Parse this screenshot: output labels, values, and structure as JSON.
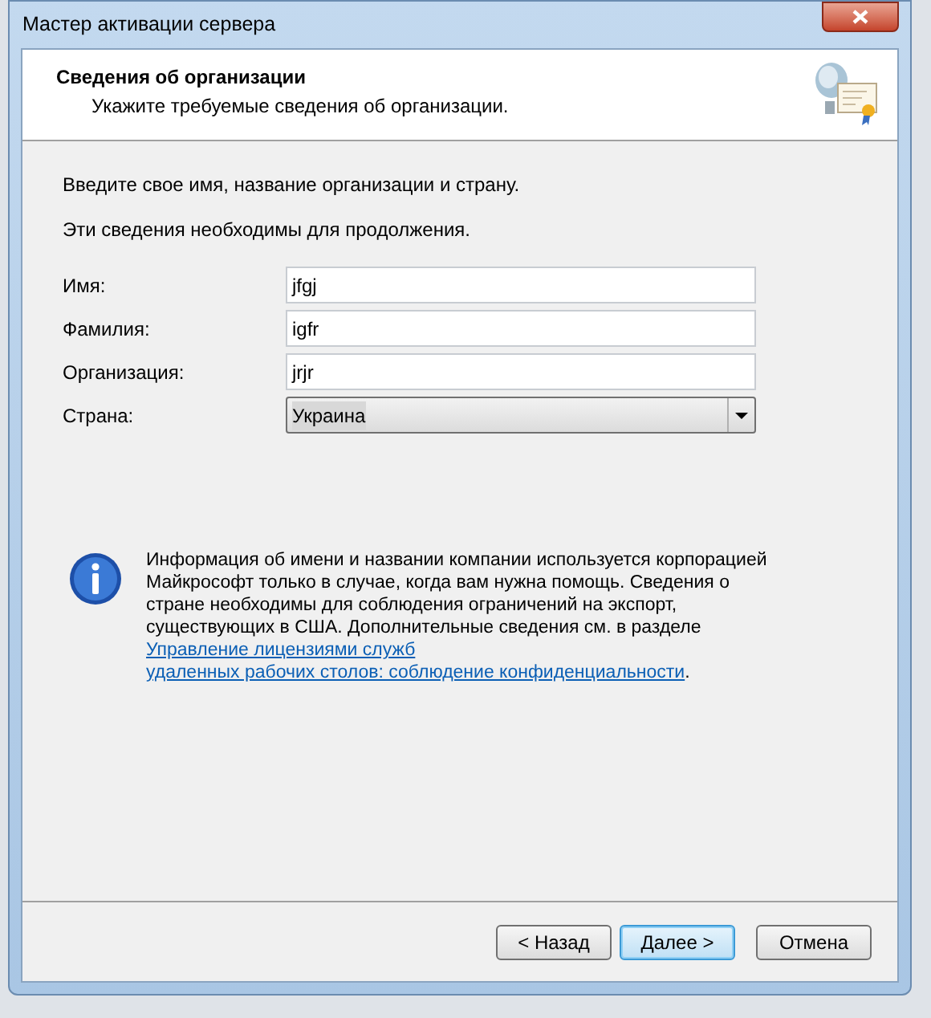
{
  "window": {
    "title": "Мастер активации сервера"
  },
  "header": {
    "title": "Сведения об организации",
    "subtitle": "Укажите требуемые сведения об организации."
  },
  "intro": [
    "Введите свое имя, название организации и страну.",
    "Эти сведения необходимы для продолжения."
  ],
  "fields": [
    {
      "kind": "text",
      "label": "Имя:",
      "value": "jfgj"
    },
    {
      "kind": "text",
      "label": "Фамилия:",
      "value": "igfr"
    },
    {
      "kind": "text",
      "label": "Организация:",
      "value": "jrjr"
    },
    {
      "kind": "select",
      "label": "Страна:",
      "value": "Украина"
    }
  ],
  "info": {
    "text": "Информация об имени и названии компании используется корпорацией Майкрософт только в случае, когда вам нужна помощь. Сведения о стране необходимы для соблюдения ограничений на экспорт, существующих в США. Дополнительные сведения см. в разделе ",
    "link_lines": [
      "Управление лицензиями служб",
      "удаленных рабочих столов: соблюдение конфиденциальности"
    ],
    "after": "."
  },
  "buttons": [
    {
      "label": "< Назад",
      "focused": false
    },
    {
      "label": "Далее >",
      "focused": true
    },
    {
      "label": "Отмена",
      "focused": false
    }
  ]
}
